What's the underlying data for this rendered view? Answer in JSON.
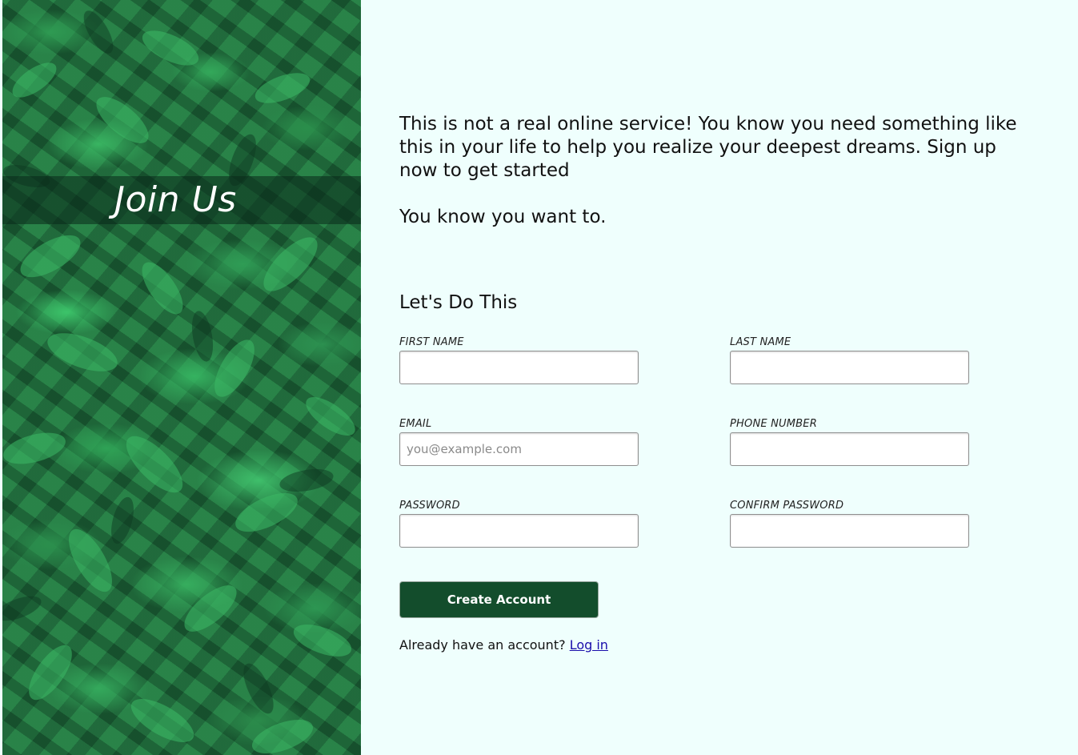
{
  "sidebar": {
    "title": "Join Us"
  },
  "intro": {
    "paragraph1": "This is not a real online service! You know you need something like this in your life to help you realize your deepest dreams. Sign up now to get started",
    "paragraph2": "You know you want to."
  },
  "form": {
    "heading": "Let's Do This",
    "fields": {
      "first_name": {
        "label": "FIRST NAME",
        "value": "",
        "placeholder": ""
      },
      "last_name": {
        "label": "LAST NAME",
        "value": "",
        "placeholder": ""
      },
      "email": {
        "label": "EMAIL",
        "value": "",
        "placeholder": "you@example.com"
      },
      "phone": {
        "label": "PHONE NUMBER",
        "value": "",
        "placeholder": ""
      },
      "password": {
        "label": "PASSWORD",
        "value": "",
        "placeholder": ""
      },
      "confirm_password": {
        "label": "CONFIRM PASSWORD",
        "value": "",
        "placeholder": ""
      }
    },
    "submit_label": "Create Account",
    "login_prompt": "Already have an account?",
    "login_link": "Log in"
  },
  "colors": {
    "page_background": "#effffd",
    "button_background": "#134d2c",
    "button_text": "#ffffff",
    "link": "#1a0dab",
    "sidebar_green": "#1f6e3c"
  }
}
